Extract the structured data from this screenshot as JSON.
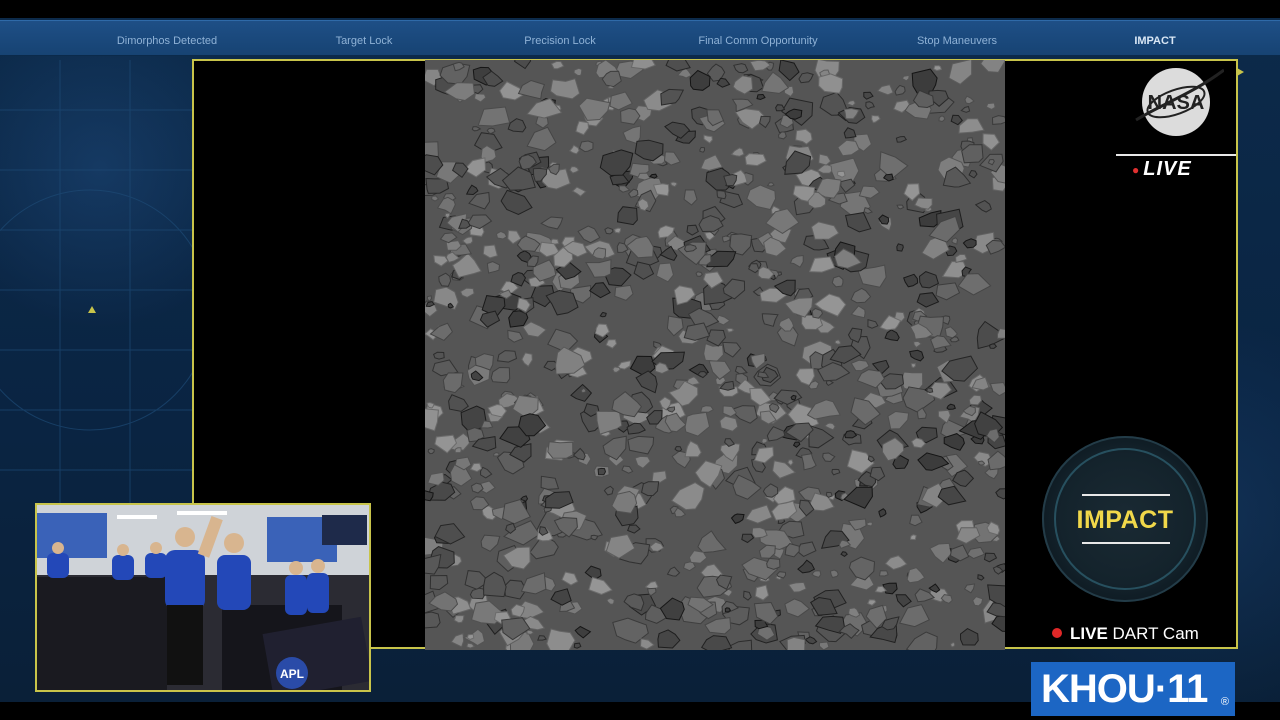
{
  "milestones": {
    "m1": "Dimorphos Detected",
    "m2": "Target Lock",
    "m3": "Precision Lock",
    "m4": "Final Comm Opportunity",
    "m5": "Stop Maneuvers",
    "m6": "IMPACT"
  },
  "live_badge": {
    "label": "LIVE"
  },
  "impact_dial": {
    "label": "IMPACT"
  },
  "dart_cam": {
    "live_label": "LIVE",
    "cam_label": "DART Cam"
  },
  "khou_logo": {
    "text": "KHOU·11",
    "registered": "®"
  },
  "nasa_logo": {
    "text": "NASA"
  },
  "inset_feed": {
    "apl_logo": "APL"
  },
  "colors": {
    "frame_border": "#c8c44a",
    "impact_text": "#f1d84a",
    "topbar": "#1e4f86",
    "khou_blue": "#1c66c4",
    "live_red": "#e02828"
  }
}
